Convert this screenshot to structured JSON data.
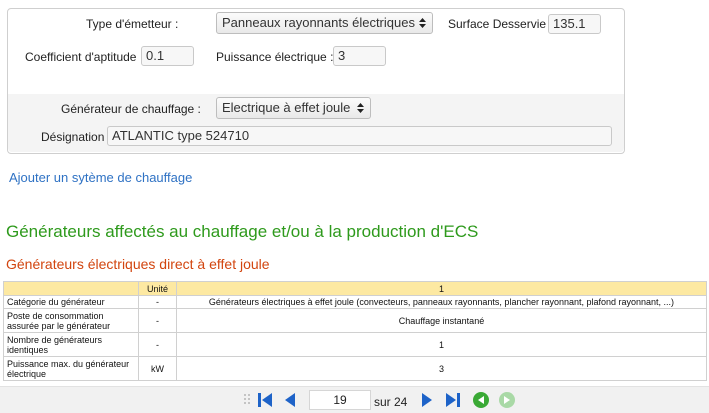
{
  "form": {
    "emitter_label": "Type d'émetteur :",
    "emitter_value": "Panneaux rayonnants électriques",
    "surface_label": "Surface Desservie :",
    "surface_value": "135.1",
    "coef_label": "Coefficient d'aptitude",
    "coef_value": "0.1",
    "power_label": "Puissance électrique :",
    "power_value": "3",
    "generator_label": "Générateur de chauffage :",
    "generator_value": "Electrique à effet joule",
    "designation_label": "Désignation",
    "designation_value": "ATLANTIC type 524710"
  },
  "add_link": "Ajouter un sytème de chauffage",
  "section_title": "Générateurs affectés au chauffage et/ou à la production d'ECS",
  "subsection_title": "Générateurs électriques direct à effet joule",
  "table": {
    "headers": [
      "",
      "Unité",
      "1"
    ],
    "rows": [
      {
        "label": "Catégorie du générateur",
        "unit": "-",
        "value": "Générateurs électriques à effet joule (convecteurs, panneaux rayonnants, plancher rayonnant, plafond rayonnant, ...)"
      },
      {
        "label": "Poste de consommation assurée par le générateur",
        "unit": "-",
        "value": "Chauffage instantané"
      },
      {
        "label": "Nombre de générateurs identiques",
        "unit": "-",
        "value": "1"
      },
      {
        "label": "Puissance max. du générateur électrique",
        "unit": "kW",
        "value": "3"
      }
    ]
  },
  "pager": {
    "current_page": "19",
    "total_label": "sur 24"
  },
  "colors": {
    "accent_blue": "#1e63c8",
    "green_title": "#2e9a1c",
    "orange_title": "#d2450f",
    "table_header": "#fde9a2"
  },
  "icons": [
    "first-page-icon",
    "previous-page-icon",
    "next-page-icon",
    "last-page-icon",
    "refresh-icon",
    "forward-icon",
    "grip-icon",
    "updown-icon"
  ]
}
